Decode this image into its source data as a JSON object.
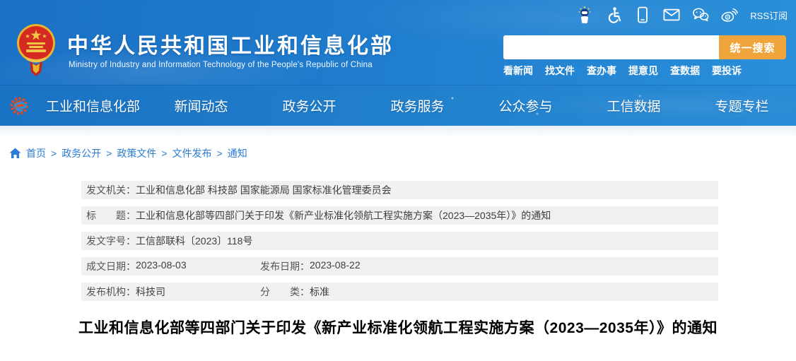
{
  "site": {
    "title": "中华人民共和国工业和信息化部",
    "subtitle": "Ministry of Industry and Information Technology of the People's Republic of China"
  },
  "topbar": {
    "icons": [
      "robot-icon",
      "accessibility-icon",
      "mobile-icon",
      "mail-icon",
      "wechat-icon",
      "weibo-icon"
    ],
    "rss_label": "RSS订阅"
  },
  "search": {
    "value": "",
    "button_label": "统一搜索",
    "quick_links": [
      "看新闻",
      "找文件",
      "查办事",
      "提意见",
      "查数据",
      "要投诉"
    ]
  },
  "nav": {
    "items": [
      "工业和信息化部",
      "新闻动态",
      "政务公开",
      "政务服务",
      "公众参与",
      "工信数据",
      "专题专栏"
    ]
  },
  "breadcrumb": {
    "separator": ">",
    "items": [
      "首页",
      "政务公开",
      "政策文件",
      "文件发布",
      "通知"
    ]
  },
  "meta": {
    "rows": [
      {
        "cells": [
          {
            "label": "发文机关：",
            "value": "工业和信息化部 科技部 国家能源局 国家标准化管理委员会"
          }
        ]
      },
      {
        "cells": [
          {
            "label": "标　　题：",
            "value": "工业和信息化部等四部门关于印发《新产业标准化领航工程实施方案（2023—2035年）》的通知"
          }
        ]
      },
      {
        "cells": [
          {
            "label": "发文字号：",
            "value": "工信部联科〔2023〕118号"
          }
        ]
      },
      {
        "cells": [
          {
            "label": "成文日期：",
            "value": "2023-08-03"
          },
          {
            "label": "发布日期：",
            "value": "2023-08-22"
          }
        ]
      },
      {
        "cells": [
          {
            "label": "发布机构：",
            "value": "科技司"
          },
          {
            "label": "分　　类：",
            "value": "标准"
          }
        ]
      }
    ]
  },
  "article": {
    "title": "工业和信息化部等四部门关于印发《新产业标准化领航工程实施方案（2023—2035年）》的通知"
  },
  "colors": {
    "header_blue_start": "#1a70c4",
    "header_blue_end": "#2a8fd9",
    "search_button_orange": "#f0a53c",
    "link_blue": "#2a7cd5",
    "meta_row_gray": "#f1f1f1",
    "emblem_red": "#d42a21",
    "emblem_gold": "#f0c447"
  }
}
